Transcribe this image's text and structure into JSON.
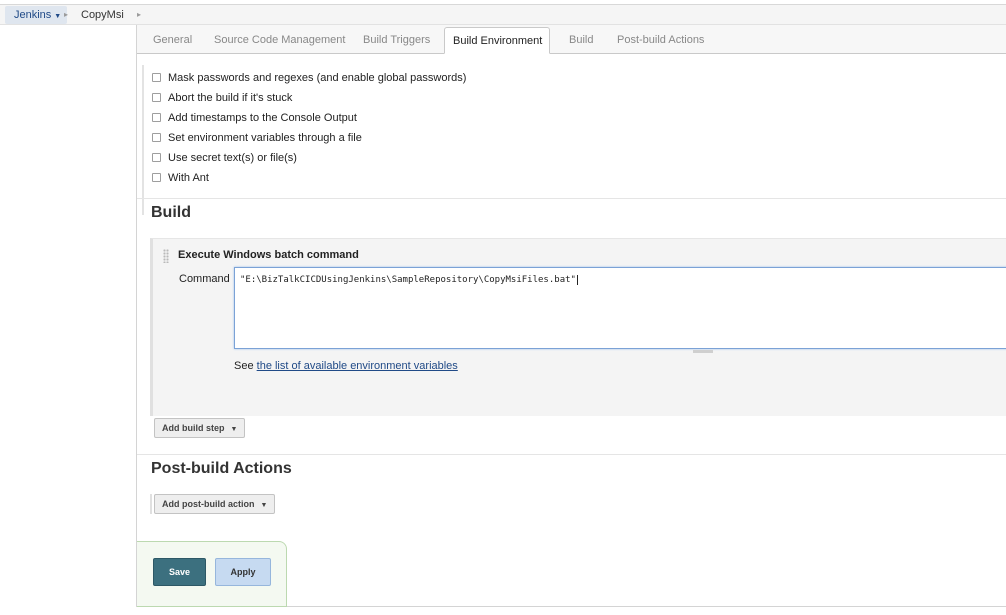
{
  "breadcrumb": {
    "root": "Jenkins",
    "item": "CopyMsi"
  },
  "tabs": [
    {
      "label": "General"
    },
    {
      "label": "Source Code Management"
    },
    {
      "label": "Build Triggers"
    },
    {
      "label": "Build Environment",
      "active": true
    },
    {
      "label": "Build"
    },
    {
      "label": "Post-build Actions"
    }
  ],
  "build_environment": {
    "options": [
      "Mask passwords and regexes (and enable global passwords)",
      "Abort the build if it's stuck",
      "Add timestamps to the Console Output",
      "Set environment variables through a file",
      "Use secret text(s) or file(s)",
      "With Ant"
    ]
  },
  "build": {
    "title": "Build",
    "step": {
      "title": "Execute Windows batch command",
      "command_label": "Command",
      "command_value": "\"E:\\BizTalkCICDUsingJenkins\\SampleRepository\\CopyMsiFiles.bat\"",
      "see_prefix": "See ",
      "see_link": "the list of available environment variables"
    },
    "add_step_label": "Add build step"
  },
  "post_build": {
    "title": "Post-build Actions",
    "add_action_label": "Add post-build action"
  },
  "footer": {
    "save_label": "Save",
    "apply_label": "Apply"
  }
}
